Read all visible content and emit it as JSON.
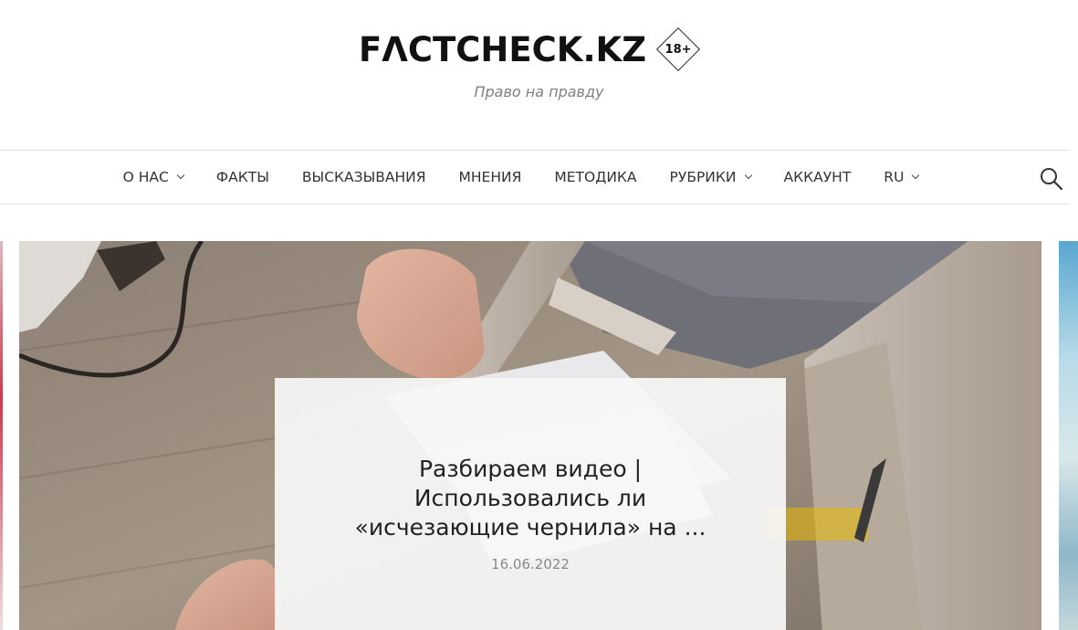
{
  "site": {
    "logo_text": "FΛCTCHECK.KZ",
    "age_rating": "18+",
    "tagline": "Право на правду"
  },
  "nav": {
    "items": [
      {
        "label": "О НАС",
        "has_dropdown": true
      },
      {
        "label": "ФАКТЫ",
        "has_dropdown": false
      },
      {
        "label": "ВЫСКАЗЫВАНИЯ",
        "has_dropdown": false
      },
      {
        "label": "МНЕНИЯ",
        "has_dropdown": false
      },
      {
        "label": "МЕТОДИКА",
        "has_dropdown": false
      },
      {
        "label": "РУБРИКИ",
        "has_dropdown": true
      },
      {
        "label": "АККАУНТ",
        "has_dropdown": false
      },
      {
        "label": "RU",
        "has_dropdown": true
      }
    ],
    "search_icon": "search-icon"
  },
  "featured": {
    "title": "Разбираем видео | Использовались ли «исчезающие чернила» на ...",
    "date": "16.06.2022"
  },
  "colors": {
    "text": "#333333",
    "tagline": "#808080",
    "border": "#e2e2e2",
    "card_bg": "#f6f6f6"
  }
}
